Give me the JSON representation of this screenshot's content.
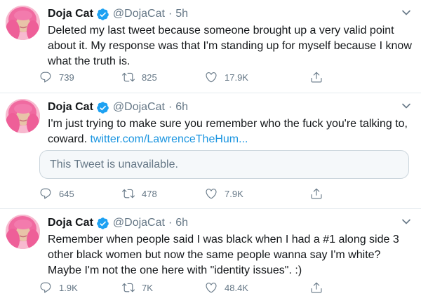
{
  "tweets": [
    {
      "name": "Doja Cat",
      "handle": "@DojaCat",
      "separator": "·",
      "time": "5h",
      "text": "Deleted my last tweet because someone brought up a very valid point about it. My response was that I'm standing up for myself because I know what the truth is.",
      "replies": "739",
      "retweets": "825",
      "likes": "17.9K"
    },
    {
      "name": "Doja Cat",
      "handle": "@DojaCat",
      "separator": "·",
      "time": "6h",
      "text": "I'm just trying to make sure you remember who the fuck you're talking to, coward.",
      "link": "twitter.com/LawrenceTheHum...",
      "quote": "This Tweet is unavailable.",
      "replies": "645",
      "retweets": "478",
      "likes": "7.9K"
    },
    {
      "name": "Doja Cat",
      "handle": "@DojaCat",
      "separator": "·",
      "time": "6h",
      "text": "Remember when people said I was black when I had a #1 along side 3 other black women but now the same people wanna say I'm white? Maybe I'm not the one here with \"identity issues\". :)",
      "replies": "1.9K",
      "retweets": "7K",
      "likes": "48.4K"
    }
  ],
  "icons": {
    "verified": "verified-badge-icon",
    "caret": "chevron-down-icon",
    "reply": "reply-icon",
    "retweet": "retweet-icon",
    "like": "heart-icon",
    "share": "share-icon"
  },
  "colors": {
    "accent": "#1da1f2",
    "link": "#1b95e0",
    "muted": "#657786",
    "avatar_hair": "#f06aa0"
  }
}
